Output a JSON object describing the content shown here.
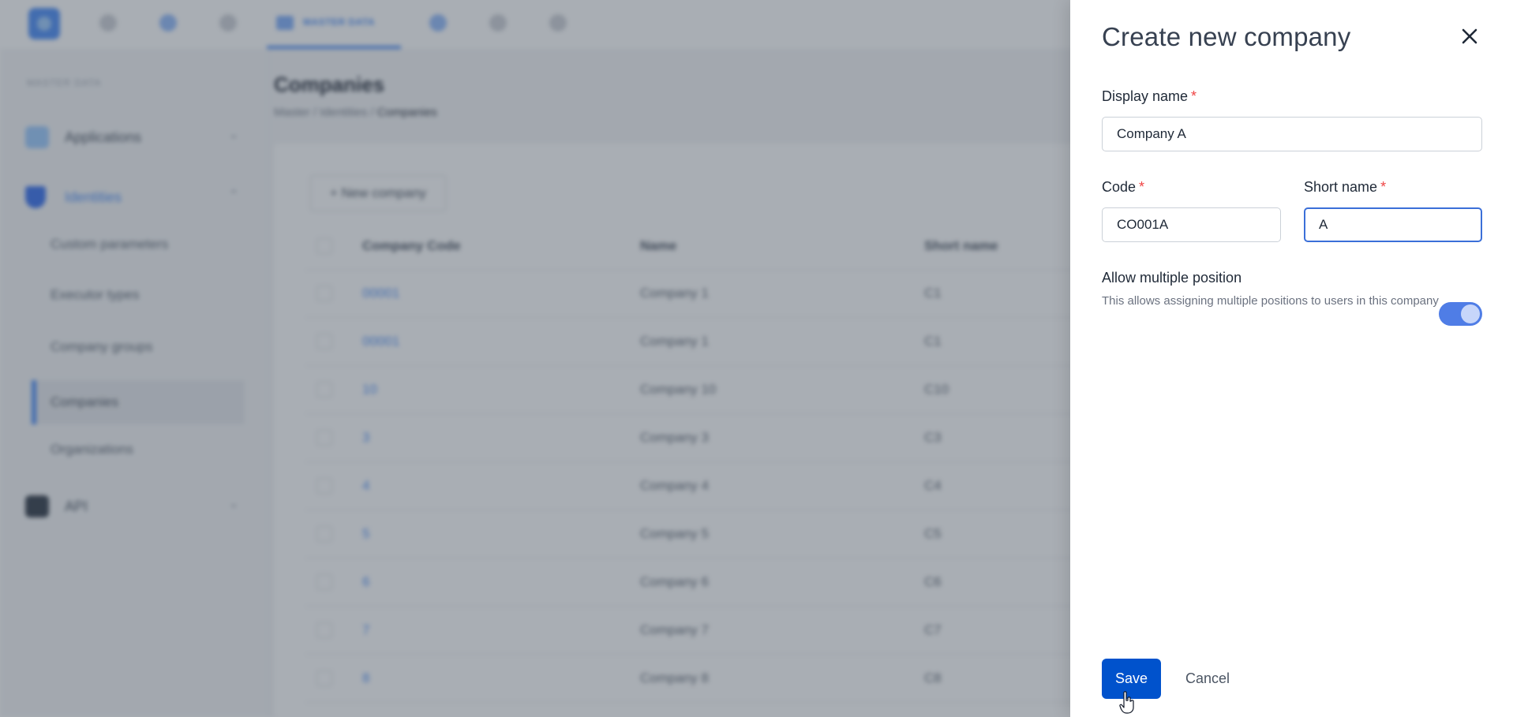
{
  "topbar": {
    "active_tab_label": "MASTER DATA"
  },
  "sidebar": {
    "heading": "MASTER DATA",
    "items": [
      {
        "label": "Applications"
      },
      {
        "label": "Identities"
      },
      {
        "label": "API"
      }
    ],
    "sub_items": [
      {
        "label": "Custom parameters"
      },
      {
        "label": "Executor types"
      },
      {
        "label": "Company groups"
      },
      {
        "label": "Companies"
      },
      {
        "label": "Organizations"
      }
    ]
  },
  "main": {
    "title": "Companies",
    "breadcrumb": {
      "part1": "Master",
      "part2": "Identities",
      "part3": "Companies",
      "sep": "/"
    },
    "new_button_label": "+ New company",
    "table": {
      "headers": {
        "code": "Company Code",
        "name": "Name",
        "short": "Short name"
      },
      "rows": [
        {
          "code": "00001",
          "name": "Company 1",
          "short": "C1"
        },
        {
          "code": "00001",
          "name": "Company 1",
          "short": "C1"
        },
        {
          "code": "10",
          "name": "Company 10",
          "short": "C10"
        },
        {
          "code": "3",
          "name": "Company 3",
          "short": "C3"
        },
        {
          "code": "4",
          "name": "Company 4",
          "short": "C4"
        },
        {
          "code": "5",
          "name": "Company 5",
          "short": "C5"
        },
        {
          "code": "6",
          "name": "Company 6",
          "short": "C6"
        },
        {
          "code": "7",
          "name": "Company 7",
          "short": "C7"
        },
        {
          "code": "8",
          "name": "Company 8",
          "short": "C8"
        }
      ]
    }
  },
  "drawer": {
    "title": "Create new company",
    "required_mark": "*",
    "display_name": {
      "label": "Display name",
      "value": "Company A"
    },
    "code": {
      "label": "Code",
      "value": "CO001A"
    },
    "short_name": {
      "label": "Short name",
      "value": "A"
    },
    "multi_position": {
      "title": "Allow multiple position",
      "description": "This allows assigning multiple positions to users in this company",
      "enabled": true
    },
    "save_label": "Save",
    "cancel_label": "Cancel"
  },
  "colors": {
    "primary": "#0052cc",
    "toggle_on": "#4f7de6",
    "required": "#ef4444",
    "focus_border": "#3b6fd8"
  }
}
